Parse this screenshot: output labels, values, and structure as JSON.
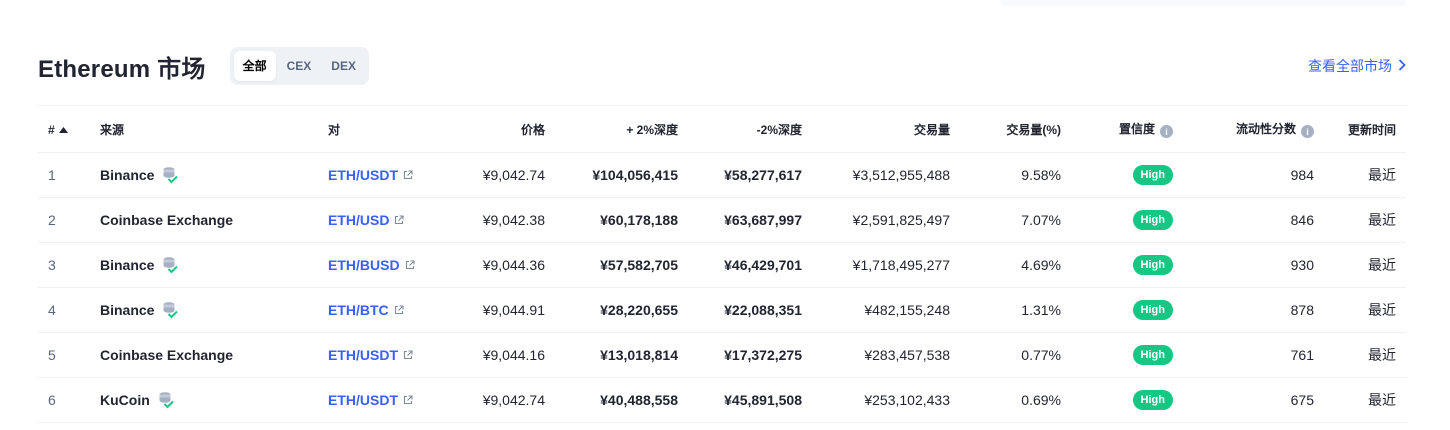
{
  "market": {
    "title": "Ethereum 市场",
    "tabs": [
      {
        "label": "全部",
        "active": true
      },
      {
        "label": "CEX",
        "active": false
      },
      {
        "label": "DEX",
        "active": false
      }
    ],
    "view_all_label": "查看全部市场"
  },
  "table": {
    "headers": {
      "rank": "#",
      "source": "来源",
      "pair": "对",
      "price": "价格",
      "depth_plus": "+ 2%深度",
      "depth_minus": "-2%深度",
      "volume": "交易量",
      "volume_pct": "交易量(%)",
      "confidence": "置信度",
      "liquidity": "流动性分数",
      "updated": "更新时间"
    },
    "rows": [
      {
        "rank": "1",
        "source": "Binance",
        "has_icon": true,
        "pair": "ETH/USDT",
        "price": "¥9,042.74",
        "depth_plus": "¥104,056,415",
        "depth_minus": "¥58,277,617",
        "volume": "¥3,512,955,488",
        "volume_pct": "9.58%",
        "confidence": "High",
        "liquidity": "984",
        "updated": "最近"
      },
      {
        "rank": "2",
        "source": "Coinbase Exchange",
        "has_icon": false,
        "pair": "ETH/USD",
        "price": "¥9,042.38",
        "depth_plus": "¥60,178,188",
        "depth_minus": "¥63,687,997",
        "volume": "¥2,591,825,497",
        "volume_pct": "7.07%",
        "confidence": "High",
        "liquidity": "846",
        "updated": "最近"
      },
      {
        "rank": "3",
        "source": "Binance",
        "has_icon": true,
        "pair": "ETH/BUSD",
        "price": "¥9,044.36",
        "depth_plus": "¥57,582,705",
        "depth_minus": "¥46,429,701",
        "volume": "¥1,718,495,277",
        "volume_pct": "4.69%",
        "confidence": "High",
        "liquidity": "930",
        "updated": "最近"
      },
      {
        "rank": "4",
        "source": "Binance",
        "has_icon": true,
        "pair": "ETH/BTC",
        "price": "¥9,044.91",
        "depth_plus": "¥28,220,655",
        "depth_minus": "¥22,088,351",
        "volume": "¥482,155,248",
        "volume_pct": "1.31%",
        "confidence": "High",
        "liquidity": "878",
        "updated": "最近"
      },
      {
        "rank": "5",
        "source": "Coinbase Exchange",
        "has_icon": false,
        "pair": "ETH/USDT",
        "price": "¥9,044.16",
        "depth_plus": "¥13,018,814",
        "depth_minus": "¥17,372,275",
        "volume": "¥283,457,538",
        "volume_pct": "0.77%",
        "confidence": "High",
        "liquidity": "761",
        "updated": "最近"
      },
      {
        "rank": "6",
        "source": "KuCoin",
        "has_icon": true,
        "pair": "ETH/USDT",
        "price": "¥9,042.74",
        "depth_plus": "¥40,488,558",
        "depth_minus": "¥45,891,508",
        "volume": "¥253,102,433",
        "volume_pct": "0.69%",
        "confidence": "High",
        "liquidity": "675",
        "updated": "最近"
      }
    ]
  },
  "icons": {
    "sort": "sort-ascending-icon",
    "info": "info-icon",
    "external_link": "external-link-icon",
    "verified_coin": "verified-stack-icon",
    "chevron": "chevron-right-icon"
  },
  "colors": {
    "link": "#3861fb",
    "badge_high": "#16c784",
    "muted": "#58667e",
    "text": "#222531"
  }
}
